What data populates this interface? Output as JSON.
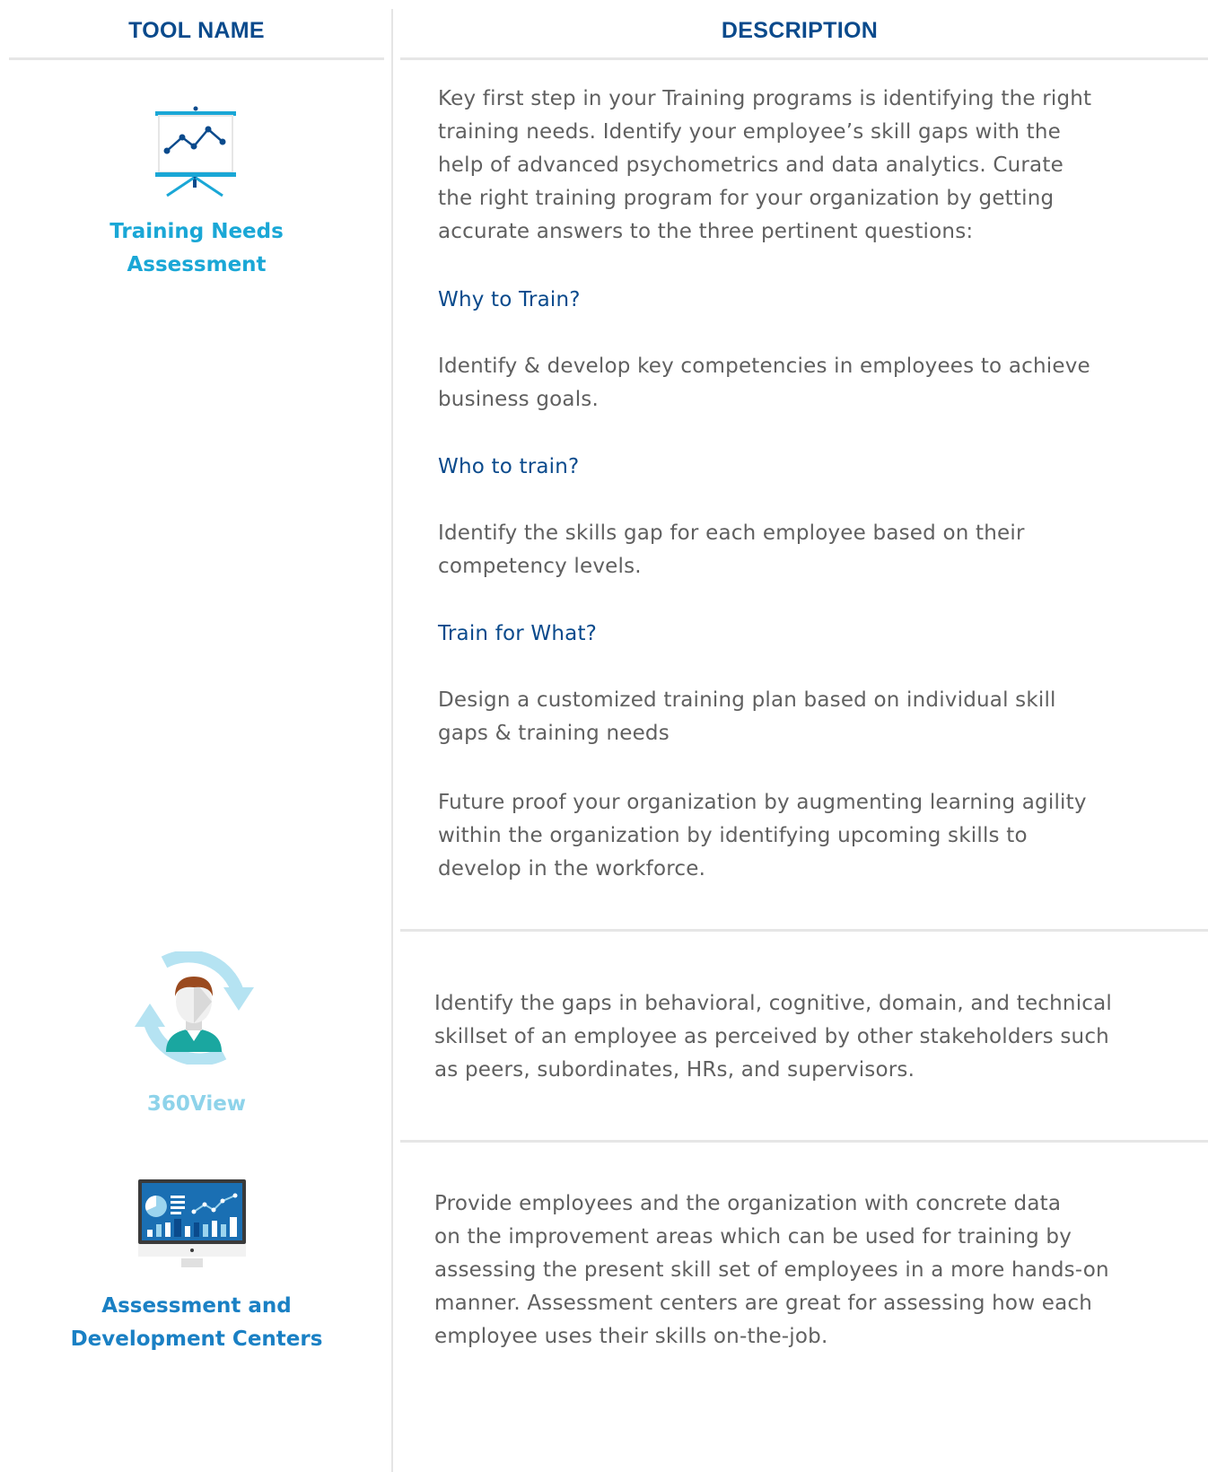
{
  "header": {
    "col1": "TOOL NAME",
    "col2": "DESCRIPTION"
  },
  "colors": {
    "heading": "#0a4a8c",
    "tool_title_1": "#1aa7d6",
    "tool_title_2": "#8ed3ea",
    "tool_title_3": "#1a80c4",
    "body_text": "#606060",
    "divider": "#e6e6e6"
  },
  "tools": [
    {
      "icon": "presentation-chart-icon",
      "name_lines": [
        "Training Needs",
        "Assessment"
      ],
      "intro_lines": [
        "Key first step in your Training programs is identifying the right",
        "training needs. Identify your employee’s skill gaps with the",
        "help of advanced psychometrics and data analytics. Curate",
        "the right training program for your organization by getting",
        "accurate answers to the three pertinent questions:"
      ],
      "questions": [
        {
          "question": "Why to Train?",
          "answer_lines": [
            "Identify & develop key competencies in employees to achieve",
            "business goals."
          ]
        },
        {
          "question": "Who to train?",
          "answer_lines": [
            "Identify the skills gap for each employee based on their",
            "competency levels."
          ]
        },
        {
          "question": "Train for What?",
          "answer_lines": [
            "Design a customized training plan based on individual skill",
            "gaps & training needs"
          ]
        }
      ],
      "closing_lines": [
        "Future proof your organization by augmenting learning agility",
        "within the organization by identifying upcoming skills to",
        "develop in the workforce."
      ]
    },
    {
      "icon": "360-person-cycle-icon",
      "name_lines": [
        "360View"
      ],
      "description_lines": [
        "Identify the gaps in behavioral, cognitive, domain, and technical",
        "skillset of an employee as perceived by other stakeholders such",
        "as peers, subordinates, HRs, and supervisors."
      ]
    },
    {
      "icon": "monitor-dashboard-icon",
      "name_lines": [
        "Assessment and",
        "Development Centers"
      ],
      "description_lines": [
        "Provide employees and the organization with concrete data",
        "on the improvement areas which can be used for training by",
        "assessing the present skill set of employees in a more hands-on",
        "manner. Assessment centers are great for assessing how each",
        "employee uses their skills on-the-job."
      ]
    }
  ]
}
